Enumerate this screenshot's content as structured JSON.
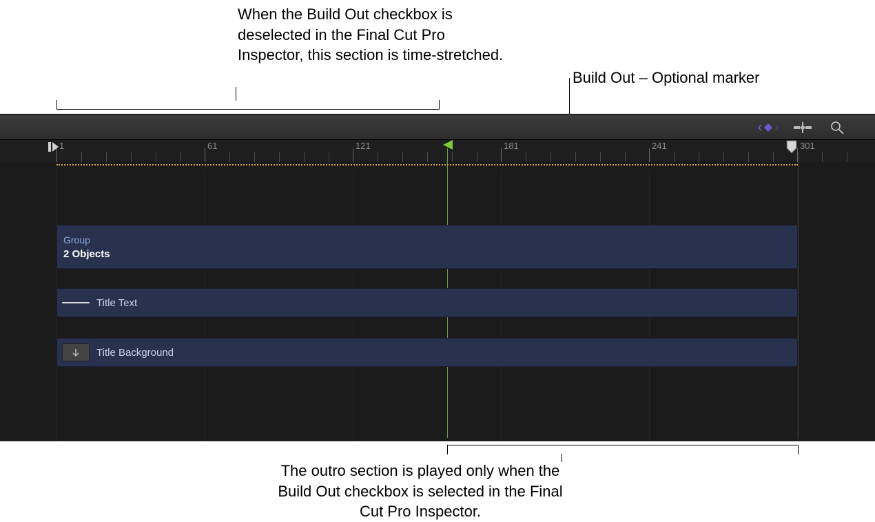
{
  "annotations": {
    "top_left": "When the Build Out checkbox is deselected in the Final Cut Pro Inspector, this section is time-stretched.",
    "top_right": "Build Out – Optional marker",
    "bottom": "The outro section is played only when the Build Out checkbox is selected in the Final Cut Pro Inspector."
  },
  "ruler": {
    "labels": [
      "1",
      "61",
      "121",
      "181",
      "241",
      "301"
    ]
  },
  "marker": {
    "name": "Build Out",
    "type": "Optional"
  },
  "tracks": {
    "group": {
      "title": "Group",
      "subtitle": "2 Objects"
    },
    "text": {
      "label": "Title Text"
    },
    "bg": {
      "label": "Title Background"
    }
  },
  "icons": {
    "keyframe": "keyframe-nav-icon",
    "snap": "snap-icon",
    "zoom": "zoom-icon"
  }
}
